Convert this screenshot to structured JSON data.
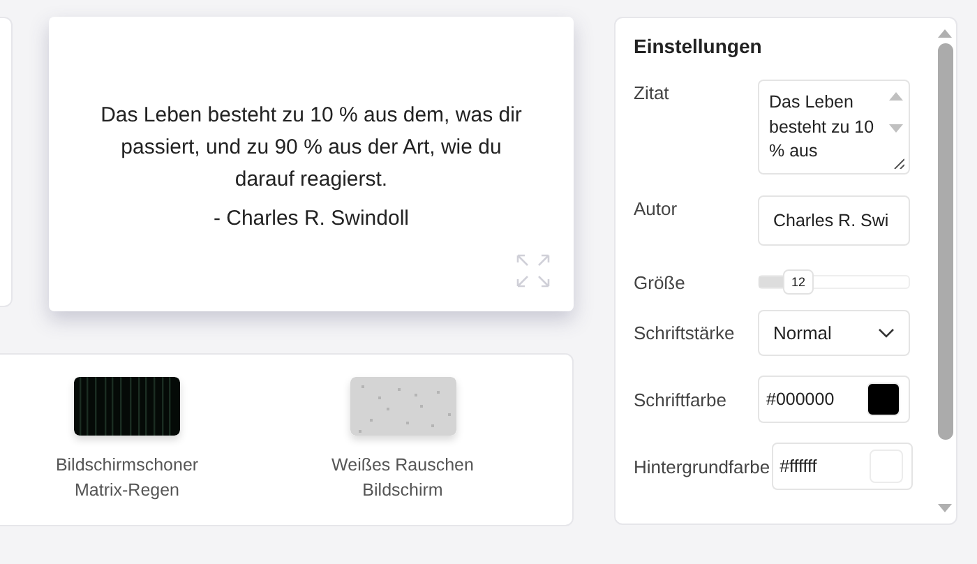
{
  "preview": {
    "quote": "Das Leben besteht zu 10 % aus dem, was dir passiert, und zu 90 % aus der Art, wie du darauf reagierst.",
    "author": "- Charles R. Swindoll"
  },
  "screensavers": [
    {
      "title": "Bildschirmschoner Matrix-Regen",
      "kind": "matrix"
    },
    {
      "title": "Weißes Rauschen Bildschirm",
      "kind": "noise"
    }
  ],
  "settings": {
    "title": "Einstellungen",
    "fields": [
      {
        "kind": "textarea",
        "label": "Zitat",
        "value": "Das Leben besteht zu 10 % aus"
      },
      {
        "kind": "text",
        "label": "Autor",
        "value": "Charles R. Swi"
      },
      {
        "kind": "slider",
        "label": "Größe",
        "level": 0.22,
        "reading": "12"
      },
      {
        "kind": "select",
        "label": "Schriftstärke",
        "value": "Normal"
      },
      {
        "kind": "color",
        "label": "Schriftfarbe",
        "value": "#000000",
        "color": "#000000"
      },
      {
        "kind": "color",
        "label": "Hintergrundfarbe",
        "value": "#ffffff",
        "color": "#ffffff"
      }
    ]
  }
}
